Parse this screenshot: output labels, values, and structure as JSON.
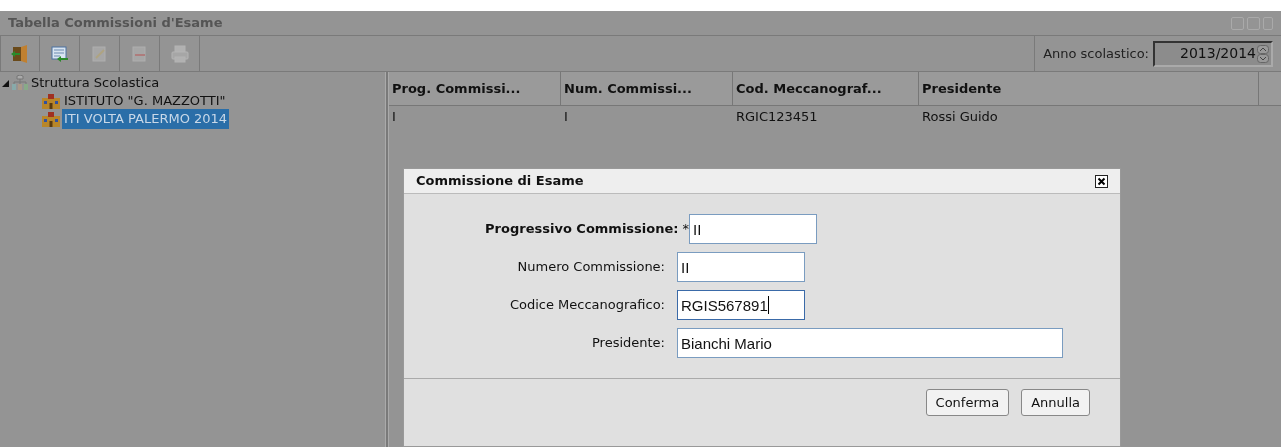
{
  "window": {
    "title": "Tabella Commissioni d'Esame"
  },
  "toolbar": {
    "buttons": [
      {
        "kind": "exit",
        "disabled": false
      },
      {
        "kind": "back",
        "disabled": false
      },
      {
        "kind": "edit",
        "disabled": true
      },
      {
        "kind": "remove",
        "disabled": true
      },
      {
        "kind": "print",
        "disabled": true
      }
    ],
    "year_label": "Anno scolastico:",
    "year_value": "2013/2014"
  },
  "tree": {
    "label": "Struttura Scolastica",
    "expanded": true,
    "children": [
      {
        "label": "ISTITUTO \"G. MAZZOTTI\"",
        "selected": false
      },
      {
        "label": "ITI VOLTA PALERMO 2014",
        "selected": true
      }
    ]
  },
  "table": {
    "columns": [
      "Prog. Commissi...",
      "Num. Commissi...",
      "Cod. Meccanograf...",
      "Presidente"
    ],
    "rows": [
      [
        "I",
        "I",
        "RGIC123451",
        "Rossi Guido"
      ]
    ]
  },
  "dialog": {
    "title": "Commissione di Esame",
    "fields": [
      {
        "label": "Progressivo Commissione:",
        "required": true,
        "kind": "short",
        "value": "II",
        "focused": false
      },
      {
        "label": "Numero Commissione:",
        "required": false,
        "kind": "short",
        "value": "II",
        "focused": false
      },
      {
        "label": "Codice Meccanografico:",
        "required": false,
        "kind": "short",
        "value": "RGIS567891",
        "focused": true
      },
      {
        "label": "Presidente:",
        "required": false,
        "kind": "long",
        "value": "Bianchi Mario",
        "focused": false
      }
    ],
    "required_mark": "*",
    "buttons": [
      "Conferma",
      "Annulla"
    ]
  }
}
